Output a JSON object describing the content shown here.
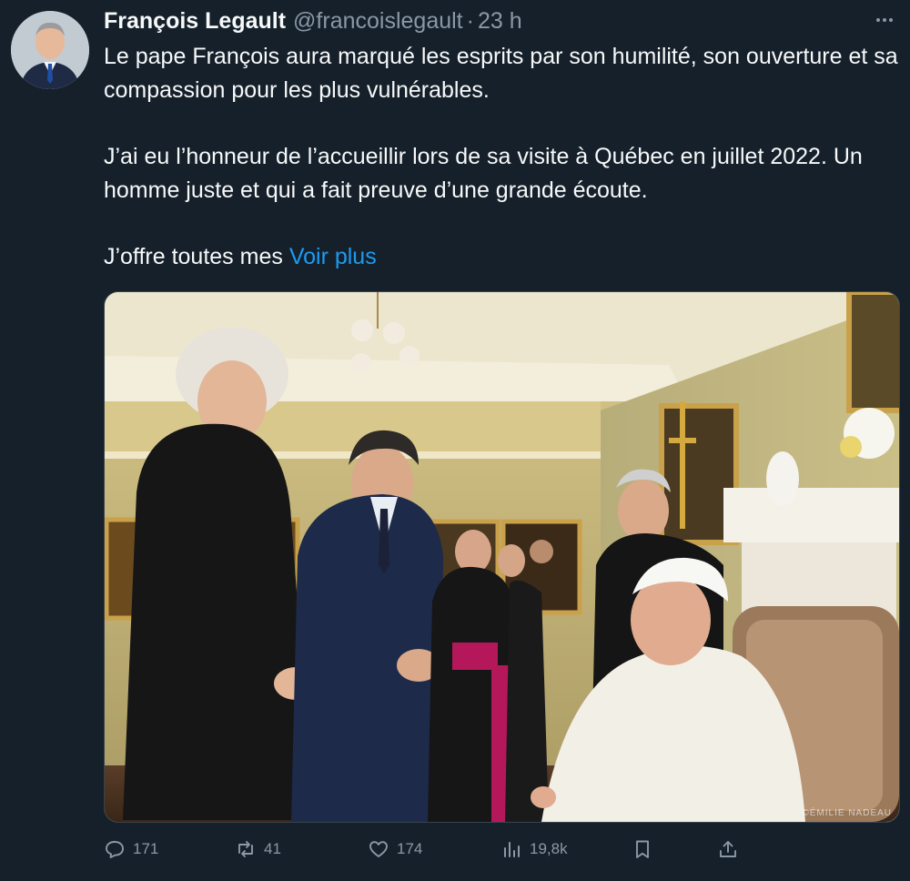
{
  "author": {
    "name": "François Legault",
    "handle": "@francoislegault",
    "separator": "·",
    "time": "23 h"
  },
  "tweet": {
    "paragraph1": "Le pape François aura marqué les esprits par son humilité, son ouverture et sa compassion pour les plus vulnérables.",
    "paragraph2": "J’ai eu l’honneur de l’accueillir lors de sa visite à Québec en juillet 2022. Un homme juste et qui a fait preuve d’une grande écoute.",
    "paragraph3": "J’offre toutes mes",
    "show_more": "Voir plus"
  },
  "media": {
    "credit": "©ÉMILIE NADEAU"
  },
  "actions": {
    "replies": "171",
    "reposts": "41",
    "likes": "174",
    "views": "19,8k"
  },
  "icons": {
    "more": "more-dots-icon",
    "reply": "reply-icon",
    "repost": "repost-icon",
    "like": "like-icon",
    "views": "views-icon",
    "bookmark": "bookmark-icon",
    "share": "share-icon"
  },
  "colors": {
    "background": "#15202b",
    "text": "#f7f9f9",
    "secondary": "#8b98a5",
    "link": "#1d9bf0"
  }
}
